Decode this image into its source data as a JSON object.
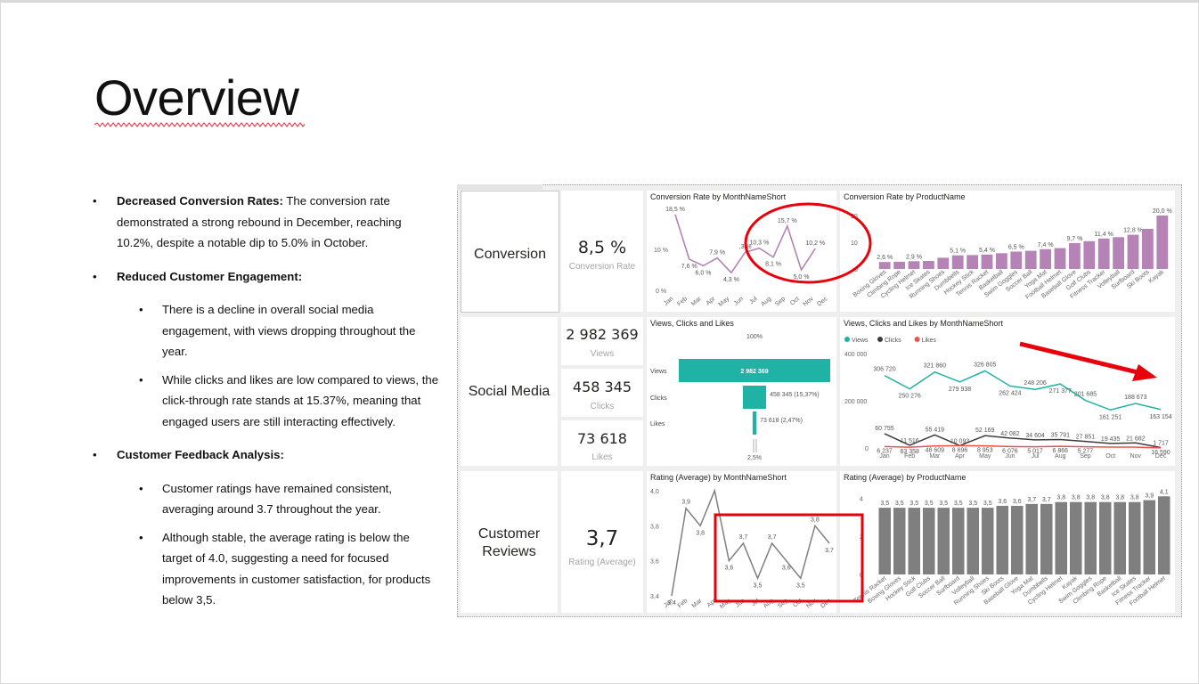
{
  "slide": {
    "title": "Overview",
    "bullets": [
      {
        "bold": "Decreased Conversion Rates:",
        "text": " The conversion rate demonstrated a strong rebound in December, reaching 10.2%, despite a notable dip to 5.0% in October."
      },
      {
        "bold": "Reduced Customer Engagement:",
        "text": "",
        "sub": [
          "There is a decline in overall social media engagement, with views dropping throughout the year.",
          "While clicks and likes are low compared to views, the click-through rate stands at 15.37%, meaning that engaged users are still interacting effectively."
        ]
      },
      {
        "bold": "Customer Feedback Analysis:",
        "text": "",
        "sub": [
          "Customer ratings have remained consistent, averaging around 3.7 throughout the year.",
          "Although stable, the average rating is below the target of 4.0, suggesting a need for focused improvements in customer satisfaction, for products below 3,5."
        ]
      }
    ]
  },
  "dashboard": {
    "sections": {
      "conversion": "Conversion",
      "social": "Social Media",
      "reviews_line1": "Customer",
      "reviews_line2": "Reviews"
    },
    "kpis": {
      "conversion": {
        "value": "8,5 %",
        "label": "Conversion Rate"
      },
      "views": {
        "value": "2 982 369",
        "label": "Views"
      },
      "clicks": {
        "value": "458 345",
        "label": "Clicks"
      },
      "likes": {
        "value": "73 618",
        "label": "Likes"
      },
      "rating": {
        "value": "3,7",
        "label": "Rating (Average)"
      }
    },
    "colors": {
      "purple": "#b583b6",
      "teal": "#20b2a5",
      "dark": "#3c3c3c",
      "red": "#e8544a",
      "gray": "#7f7f7f",
      "annotation": "#e8000b"
    }
  },
  "chart_data": [
    {
      "type": "line",
      "title": "Conversion Rate by MonthNameShort",
      "x": [
        "Jan",
        "Feb",
        "Mar",
        "Apr",
        "May",
        "Jun",
        "Jul",
        "Aug",
        "Sep",
        "Oct",
        "Nov",
        "Dec"
      ],
      "values": [
        18.5,
        7.6,
        6.0,
        7.9,
        4.3,
        9.3,
        10.3,
        8.1,
        15.7,
        5.0,
        10.2,
        null
      ],
      "labels": [
        "18,5 %",
        "7,6 %",
        "6,0 %",
        "7,9 %",
        "4,3 %",
        ",3 %",
        "10,3 %",
        "8,1 %",
        "15,7 %",
        "5,0 %",
        "10,2 %",
        ""
      ],
      "yticks": [
        "10 %",
        "0 %"
      ],
      "ylim": [
        0,
        20
      ]
    },
    {
      "type": "bar",
      "title": "Conversion Rate by ProductName",
      "categories": [
        "Boxing Gloves",
        "Climbing Rope",
        "Cycling Helmet",
        "Ice Skates",
        "Running Shoes",
        "Dumbbells",
        "Hockey Stick",
        "Tennis Racket",
        "Basketball",
        "Swim Goggles",
        "Soccer Ball",
        "Yoga Mat",
        "Football Helmet",
        "Baseball Glove",
        "Golf Clubs",
        "Fitness Tracker",
        "Volleyball",
        "Surfboard",
        "Ski Boots",
        "Kayak"
      ],
      "values": [
        2.6,
        2.7,
        2.9,
        3.0,
        4.2,
        5.1,
        5.2,
        5.4,
        5.9,
        6.5,
        6.8,
        7.4,
        7.8,
        9.7,
        10.4,
        11.4,
        11.9,
        12.8,
        15.0,
        20.0
      ],
      "labels": [
        "2,6 %",
        "",
        "2,9 %",
        "",
        "",
        "5,1 %",
        "",
        "5,4 %",
        "",
        "6,5 %",
        "",
        "7,4 %",
        "",
        "9,7 %",
        "",
        "11,4 %",
        "",
        "12,8 %",
        "",
        "20,0 %"
      ],
      "yticks": [
        "20",
        "10",
        "0"
      ],
      "ylim": [
        0,
        22
      ]
    },
    {
      "type": "bar",
      "title": "Views, Clicks and Likes",
      "categories": [
        "Views",
        "Clicks",
        "Likes"
      ],
      "values": [
        2982369,
        458345,
        73618
      ],
      "labels": [
        "2 982 369",
        "458 345 (15,37%)",
        "73 618 (2,47%)"
      ],
      "top_label": "100%",
      "bottom_label": "2,5%"
    },
    {
      "type": "line",
      "title": "Views, Clicks and Likes by MonthNameShort",
      "x": [
        "Jan",
        "Feb",
        "Mar",
        "Apr",
        "May",
        "Jun",
        "Jul",
        "Aug",
        "Sep",
        "Oct",
        "Nov",
        "Dec"
      ],
      "legend": [
        "Views",
        "Clicks",
        "Likes"
      ],
      "series": [
        {
          "name": "Views",
          "values": [
            306720,
            250276,
            321860,
            279938,
            326805,
            262424,
            248206,
            271377,
            201685,
            161251,
            188673,
            163154
          ],
          "labels": [
            "306 720",
            "250 276",
            "321 860",
            "279 938",
            "326 805",
            "262 424",
            "248 206",
            "271 377",
            "201 685",
            "161 251",
            "188 673",
            "163 154"
          ]
        },
        {
          "name": "Clicks",
          "values": [
            60755,
            11516,
            55419,
            10093,
            52169,
            42082,
            34604,
            35791,
            27851,
            19435,
            21682,
            1717
          ],
          "labels": [
            "60 755",
            "11 516",
            "55 419",
            "10 093",
            "52 169",
            "42 082",
            "34 604",
            "35 791",
            "27 851",
            "19 435",
            "21 682",
            "1 717"
          ]
        },
        {
          "name": "Likes",
          "values": [
            6237,
            3358,
            8696,
            9698,
            8953,
            6076,
            5017,
            6866,
            5277,
            4000,
            3500,
            590
          ],
          "labels": [
            "6 237",
            "63 358",
            "48 609",
            "8 696",
            "8 953",
            "6 076",
            "5 017",
            "6 866",
            "5 277",
            "",
            "",
            "16 590"
          ]
        }
      ],
      "yticks": [
        "400 000",
        "200 000",
        "0"
      ],
      "ylim": [
        0,
        400000
      ]
    },
    {
      "type": "line",
      "title": "Rating (Average) by MonthNameShort",
      "x": [
        "Jan",
        "Feb",
        "Mar",
        "Apr",
        "May",
        "Jun",
        "Jul",
        "Aug",
        "Sep",
        "Oct",
        "Nov",
        "Dec"
      ],
      "values": [
        3.4,
        3.9,
        3.8,
        4.0,
        3.6,
        3.7,
        3.5,
        3.7,
        3.6,
        3.5,
        3.8,
        3.7
      ],
      "labels": [
        "3,4",
        "3,9",
        "3,8",
        "",
        "3,6",
        "3,7",
        "3,5",
        "3,7",
        "3,6",
        "3,5",
        "3,8",
        "3,7"
      ],
      "yticks": [
        "4,0",
        "3,8",
        "3,6",
        "3,4"
      ],
      "ylim": [
        3.4,
        4.0
      ]
    },
    {
      "type": "bar",
      "title": "Rating (Average) by ProductName",
      "categories": [
        "Tennis Racket",
        "Boxing Gloves",
        "Hockey Stick",
        "Golf Clubs",
        "Soccer Ball",
        "Surfboard",
        "Volleyball",
        "Running Shoes",
        "Ski Boots",
        "Baseball Glove",
        "Yoga Mat",
        "Dumbbells",
        "Cycling Helmet",
        "Kayak",
        "Swim Goggles",
        "Climbing Rope",
        "Basketball",
        "Ice Skates",
        "Fitness Tracker",
        "Football Helmet"
      ],
      "values": [
        3.5,
        3.5,
        3.5,
        3.5,
        3.5,
        3.5,
        3.5,
        3.5,
        3.6,
        3.6,
        3.7,
        3.7,
        3.8,
        3.8,
        3.8,
        3.8,
        3.8,
        3.8,
        3.9,
        4.1
      ],
      "labels": [
        "3,5",
        "3,5",
        "3,5",
        "3,5",
        "3,5",
        "3,5",
        "3,5",
        "3,5",
        "3,6",
        "3,6",
        "3,7",
        "3,7",
        "3,8",
        "3,8",
        "3,8",
        "3,8",
        "3,8",
        "3,8",
        "3,9",
        "4,1"
      ],
      "yticks": [
        "4",
        "2",
        "0"
      ],
      "ylim": [
        0,
        4.3
      ]
    }
  ]
}
